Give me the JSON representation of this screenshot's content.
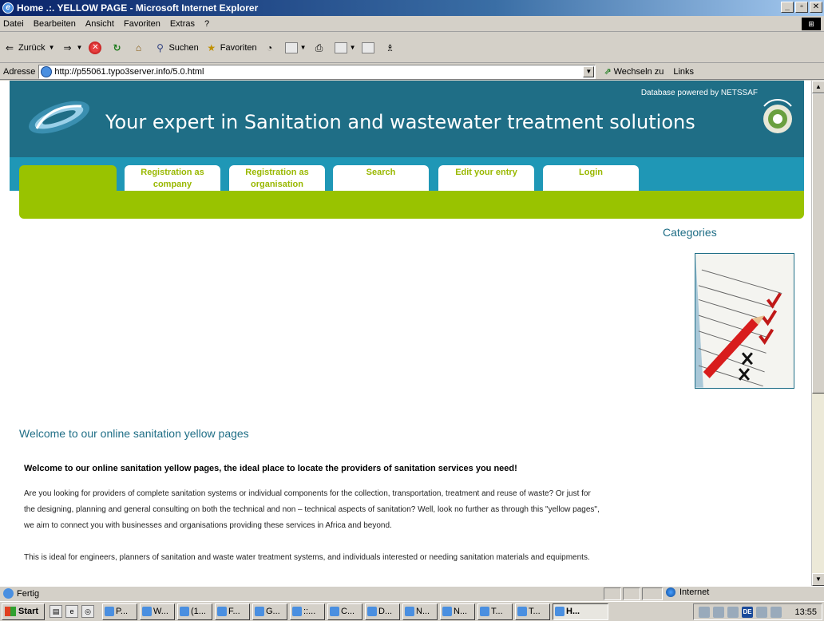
{
  "window": {
    "title": "Home .:. YELLOW PAGE - Microsoft Internet Explorer",
    "buttons": [
      "_",
      "▫",
      "✕"
    ]
  },
  "menubar": {
    "items": [
      "Datei",
      "Bearbeiten",
      "Ansicht",
      "Favoriten",
      "Extras",
      "?"
    ]
  },
  "toolbar": {
    "back_label": "Zurück",
    "search_label": "Suchen",
    "favorites_label": "Favoriten"
  },
  "addressbar": {
    "label": "Adresse",
    "url": "http://p55061.typo3server.info/5.0.html",
    "go_label": "Wechseln zu",
    "links_label": "Links"
  },
  "site": {
    "tagline": "Your expert in Sanitation and wastewater treatment solutions",
    "powered_by": "Database powered by NETSSAF",
    "nav": [
      {
        "label": "Registration as company"
      },
      {
        "label": "Registration as organisation"
      },
      {
        "label": "Search"
      },
      {
        "label": "Edit your entry"
      },
      {
        "label": "Login"
      }
    ],
    "categories_label": "Categories",
    "welcome_title": "Welcome to our online sanitation yellow pages",
    "welcome_bold": "Welcome to our online sanitation yellow pages, the ideal place to locate the providers of sanitation services you need!",
    "para1_line1": "Are you looking for providers of complete sanitation systems or individual components for the collection, transportation, treatment and reuse of waste? Or just for",
    "para1_line2": "the designing, planning and general consulting on both the technical and non – technical aspects of sanitation? Well, look no further as through this \"yellow pages\",",
    "para1_line3": "we aim to connect you with businesses and organisations providing these services in Africa and beyond.",
    "para2": "This is ideal for engineers, planners of sanitation and waste water treatment systems, and individuals interested or needing sanitation materials and equipments."
  },
  "statusbar": {
    "text": "Fertig",
    "zone": "Internet"
  },
  "taskbar": {
    "start_label": "Start",
    "tasks": [
      "P...",
      "W...",
      "(1...",
      "F...",
      "G...",
      "::...",
      "C...",
      "D...",
      "N...",
      "N...",
      "T...",
      "T...",
      "H..."
    ],
    "tray_lang": "DE",
    "clock": "13:55"
  },
  "colors": {
    "header_teal": "#1f6e86",
    "nav_blue": "#1f97b6",
    "green": "#99c300"
  }
}
